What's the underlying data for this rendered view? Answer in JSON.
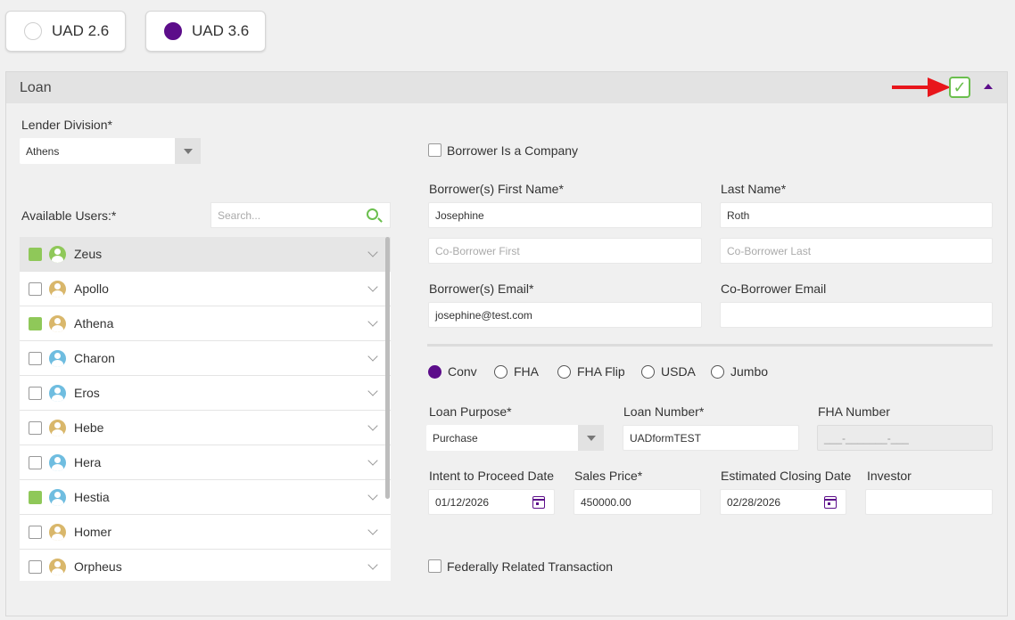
{
  "uad_versions": [
    {
      "label": "UAD 2.6",
      "selected": false
    },
    {
      "label": "UAD 3.6",
      "selected": true
    }
  ],
  "panel": {
    "title": "Loan"
  },
  "icons": {
    "arrow": "red-arrow-icon",
    "check": "checkmark-icon",
    "collapse": "triangle-up-icon",
    "search": "search-icon",
    "calendar": "calendar-icon",
    "avatar": "user-avatar-icon",
    "chevron": "chevron-down-icon"
  },
  "colors": {
    "accent": "#5c0d8a",
    "check_green": "#6bbf4e",
    "selected_checkbox": "#8fc859",
    "arrow": "#e8161b"
  },
  "lender_division": {
    "label": "Lender Division*",
    "value": "Athens"
  },
  "available_users": {
    "label": "Available Users:*",
    "search_placeholder": "Search...",
    "users": [
      {
        "name": "Zeus",
        "checked": true,
        "avatar_color": "#8fc859",
        "highlighted": true
      },
      {
        "name": "Apollo",
        "checked": false,
        "avatar_color": "#d9b76b",
        "highlighted": false
      },
      {
        "name": "Athena",
        "checked": true,
        "avatar_color": "#d9b76b",
        "highlighted": false
      },
      {
        "name": "Charon",
        "checked": false,
        "avatar_color": "#6fbde0",
        "highlighted": false
      },
      {
        "name": "Eros",
        "checked": false,
        "avatar_color": "#6fbde0",
        "highlighted": false
      },
      {
        "name": "Hebe",
        "checked": false,
        "avatar_color": "#d9b76b",
        "highlighted": false
      },
      {
        "name": "Hera",
        "checked": false,
        "avatar_color": "#6fbde0",
        "highlighted": false
      },
      {
        "name": "Hestia",
        "checked": true,
        "avatar_color": "#6fbde0",
        "highlighted": false
      },
      {
        "name": "Homer",
        "checked": false,
        "avatar_color": "#d9b76b",
        "highlighted": false
      },
      {
        "name": "Orpheus",
        "checked": false,
        "avatar_color": "#d9b76b",
        "highlighted": false
      }
    ]
  },
  "borrower": {
    "is_company_label": "Borrower Is a Company",
    "is_company_checked": false,
    "first_name_label": "Borrower(s) First Name*",
    "first_name_value": "Josephine",
    "last_name_label": "Last Name*",
    "last_name_value": "Roth",
    "co_first_placeholder": "Co-Borrower First",
    "co_last_placeholder": "Co-Borrower Last",
    "email_label": "Borrower(s) Email*",
    "email_value": "josephine@test.com",
    "co_email_label": "Co-Borrower Email",
    "co_email_value": ""
  },
  "loan_types": [
    {
      "label": "Conv",
      "selected": true
    },
    {
      "label": "FHA",
      "selected": false
    },
    {
      "label": "FHA Flip",
      "selected": false
    },
    {
      "label": "USDA",
      "selected": false
    },
    {
      "label": "Jumbo",
      "selected": false
    }
  ],
  "loan": {
    "purpose_label": "Loan Purpose*",
    "purpose_value": "Purchase",
    "number_label": "Loan Number*",
    "number_value": "UADformTEST",
    "fha_label": "FHA Number",
    "fha_placeholder": "___-_______-___",
    "intent_label": "Intent to Proceed Date",
    "intent_value": "01/12/2026",
    "sales_label": "Sales Price*",
    "sales_value": "450000.00",
    "closing_label": "Estimated Closing Date",
    "closing_value": "02/28/2026",
    "investor_label": "Investor",
    "investor_value": "",
    "federal_label": "Federally Related Transaction",
    "federal_checked": false
  }
}
